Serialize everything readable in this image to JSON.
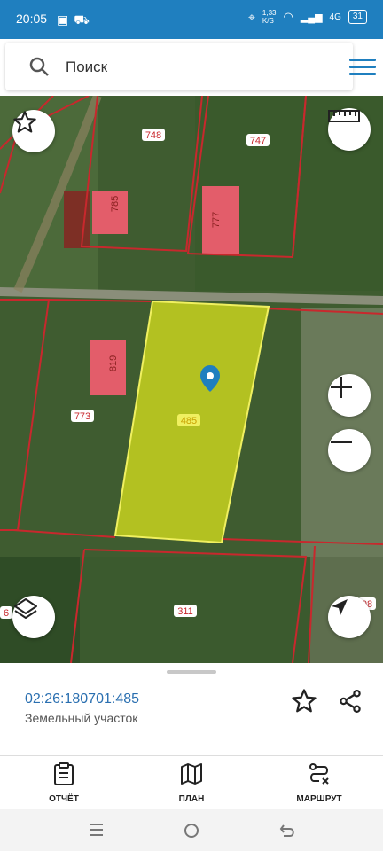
{
  "status": {
    "time": "20:05",
    "net_speed": "1,33\nK/S",
    "signal": "4G",
    "battery": "31"
  },
  "search": {
    "placeholder": "Поиск"
  },
  "map": {
    "parcel_labels": [
      "748",
      "747",
      "785",
      "777",
      "819",
      "773",
      "485",
      "311",
      "6",
      "08"
    ],
    "selected_parcel": "485"
  },
  "info": {
    "cadastral_number": "02:26:180701:485",
    "object_type": "Земельный участок"
  },
  "nav": {
    "report": "ОТЧЁТ",
    "plan": "ПЛАН",
    "route": "МАРШРУТ"
  },
  "colors": {
    "accent": "#1f7fbf",
    "parcel_border": "#c8282d",
    "selected_fill": "#c8d21e"
  }
}
